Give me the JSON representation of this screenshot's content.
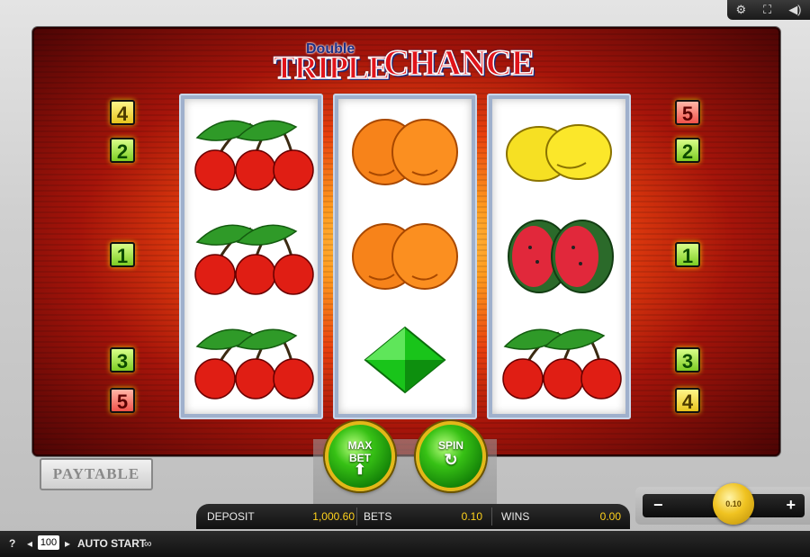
{
  "title": {
    "double": "Double",
    "triple": "TRIPLE",
    "chance": "CHANCE"
  },
  "toolbar": {
    "settings_icon": "⚙",
    "fullscreen_icon": "⛶",
    "sound_icon": "◀)"
  },
  "lines_left": [
    {
      "num": "4",
      "color": "yellow"
    },
    {
      "num": "2",
      "color": "green"
    },
    {
      "num": "1",
      "color": "green"
    },
    {
      "num": "3",
      "color": "green"
    },
    {
      "num": "5",
      "color": "red"
    }
  ],
  "lines_right": [
    {
      "num": "5",
      "color": "red"
    },
    {
      "num": "2",
      "color": "green"
    },
    {
      "num": "1",
      "color": "green"
    },
    {
      "num": "3",
      "color": "green"
    },
    {
      "num": "4",
      "color": "yellow"
    }
  ],
  "reels": [
    [
      "cherries",
      "cherries",
      "cherries"
    ],
    [
      "oranges",
      "oranges",
      "green-diamond"
    ],
    [
      "lemons",
      "watermelons",
      "cherries"
    ]
  ],
  "paytable_label": "PAYTABLE",
  "buttons": {
    "maxbet_line1": "MAX",
    "maxbet_line2": "BET",
    "spin": "SPIN"
  },
  "info": {
    "deposit_label": "DEPOSIT",
    "deposit_value": "1,000.60",
    "bets_label": "BETS",
    "bets_value": "0.10",
    "wins_label": "WINS",
    "wins_value": "0.00"
  },
  "bet_slider": {
    "minus": "−",
    "plus": "+",
    "coin_value": "0.10"
  },
  "status": {
    "help": "?",
    "autoplay_count": "100",
    "auto_start": "AUTO START"
  }
}
